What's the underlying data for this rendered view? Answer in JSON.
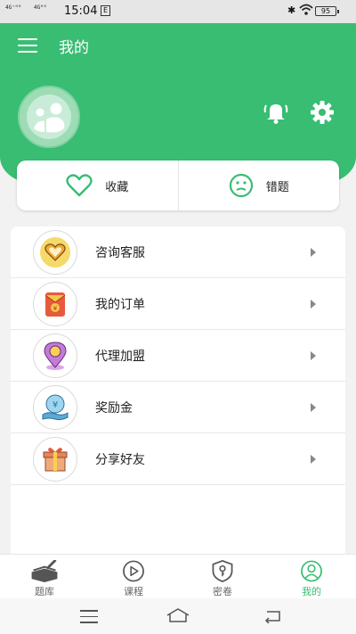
{
  "status": {
    "signal1": "4G⁺ᴴᴰ",
    "signal2": "4Gᴴᴰ",
    "time": "15:04",
    "box_glyph": "E",
    "battery": "95"
  },
  "header": {
    "title": "我的"
  },
  "favorites": [
    {
      "label": "收藏",
      "icon": "heart-icon"
    },
    {
      "label": "错题",
      "icon": "sad-face-icon"
    }
  ],
  "menu": [
    {
      "label": "咨询客服",
      "icon": "heart-badge-icon"
    },
    {
      "label": "我的订单",
      "icon": "order-envelope-icon"
    },
    {
      "label": "代理加盟",
      "icon": "location-pin-icon"
    },
    {
      "label": "奖励金",
      "icon": "reward-money-icon"
    },
    {
      "label": "分享好友",
      "icon": "gift-box-icon"
    }
  ],
  "tabs": [
    {
      "label": "题库",
      "icon": "books-icon",
      "active": false
    },
    {
      "label": "课程",
      "icon": "play-circle-icon",
      "active": false
    },
    {
      "label": "密卷",
      "icon": "shield-key-icon",
      "active": false
    },
    {
      "label": "我的",
      "icon": "profile-icon",
      "active": true
    }
  ],
  "colors": {
    "brand": "#38bd72",
    "background": "#f2f2f2"
  }
}
